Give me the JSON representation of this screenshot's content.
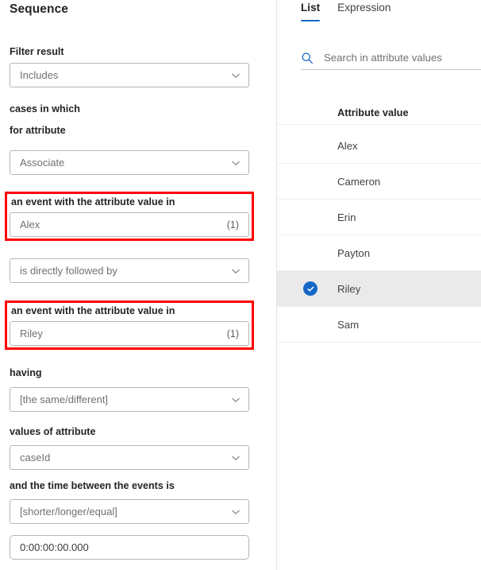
{
  "left_panel": {
    "title": "Sequence",
    "fields": [
      {
        "label": "Filter result",
        "value": "Includes",
        "kind": "select"
      },
      {
        "label": "cases in which",
        "kind": "text_only"
      },
      {
        "label": "for attribute",
        "value": "Associate",
        "kind": "select"
      },
      {
        "label": "an event with the attribute value in",
        "value": "Alex",
        "count": "(1)",
        "kind": "value_input",
        "highlighted": true
      },
      {
        "label": "",
        "value": "is directly followed by",
        "kind": "select"
      },
      {
        "label": "an event with the attribute value in",
        "value": "Riley",
        "count": "(1)",
        "kind": "value_input",
        "highlighted": true
      },
      {
        "label": "having",
        "value": "[the same/different]",
        "kind": "select"
      },
      {
        "label": "values of attribute",
        "value": "caseId",
        "kind": "select"
      },
      {
        "label": "and the time between the events is",
        "value": "[shorter/longer/equal]",
        "kind": "select"
      },
      {
        "label": "",
        "value": "0:00:00:00.000",
        "kind": "text_input"
      }
    ],
    "highlight_color": "#ff0000"
  },
  "right_panel": {
    "tabs": [
      {
        "label": "List",
        "active": true
      },
      {
        "label": "Expression",
        "active": false
      }
    ],
    "search": {
      "placeholder": "Search in attribute values",
      "value": "",
      "icon": "search-icon"
    },
    "list_header": "Attribute value",
    "values": [
      {
        "label": "Alex",
        "selected": false
      },
      {
        "label": "Cameron",
        "selected": false
      },
      {
        "label": "Erin",
        "selected": false
      },
      {
        "label": "Payton",
        "selected": false
      },
      {
        "label": "Riley",
        "selected": true
      },
      {
        "label": "Sam",
        "selected": false
      }
    ],
    "accent_color": "#1668c8",
    "selected_row_color": "#ebeaea"
  }
}
